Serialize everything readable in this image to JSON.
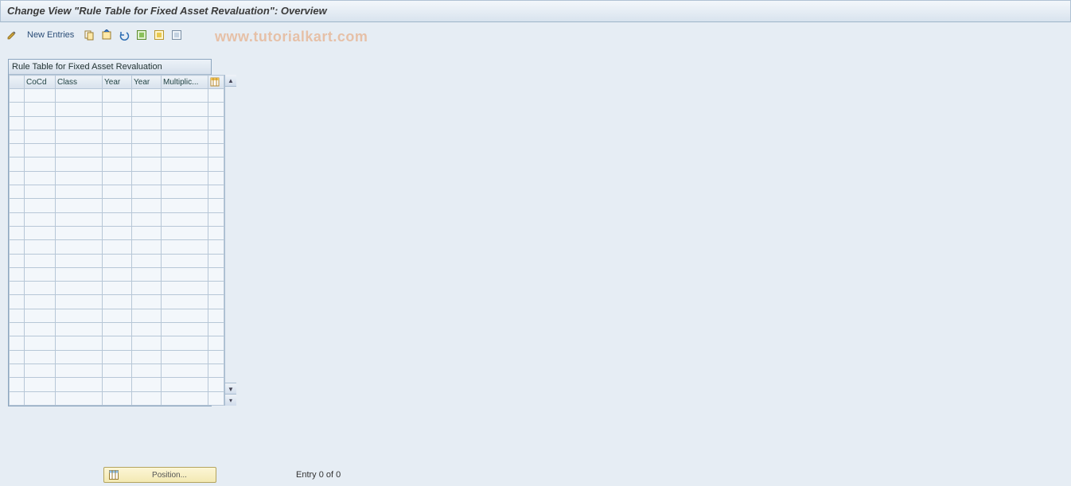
{
  "title": "Change View \"Rule Table for Fixed Asset Revaluation\": Overview",
  "toolbar": {
    "new_entries_label": "New Entries"
  },
  "watermark": "www.tutorialkart.com",
  "table": {
    "caption": "Rule Table for Fixed Asset Revaluation",
    "columns": [
      "CoCd",
      "Class",
      "Year",
      "Year",
      "Multiplic..."
    ],
    "row_count": 23
  },
  "footer": {
    "position_label": "Position...",
    "entry_text": "Entry 0 of 0"
  }
}
